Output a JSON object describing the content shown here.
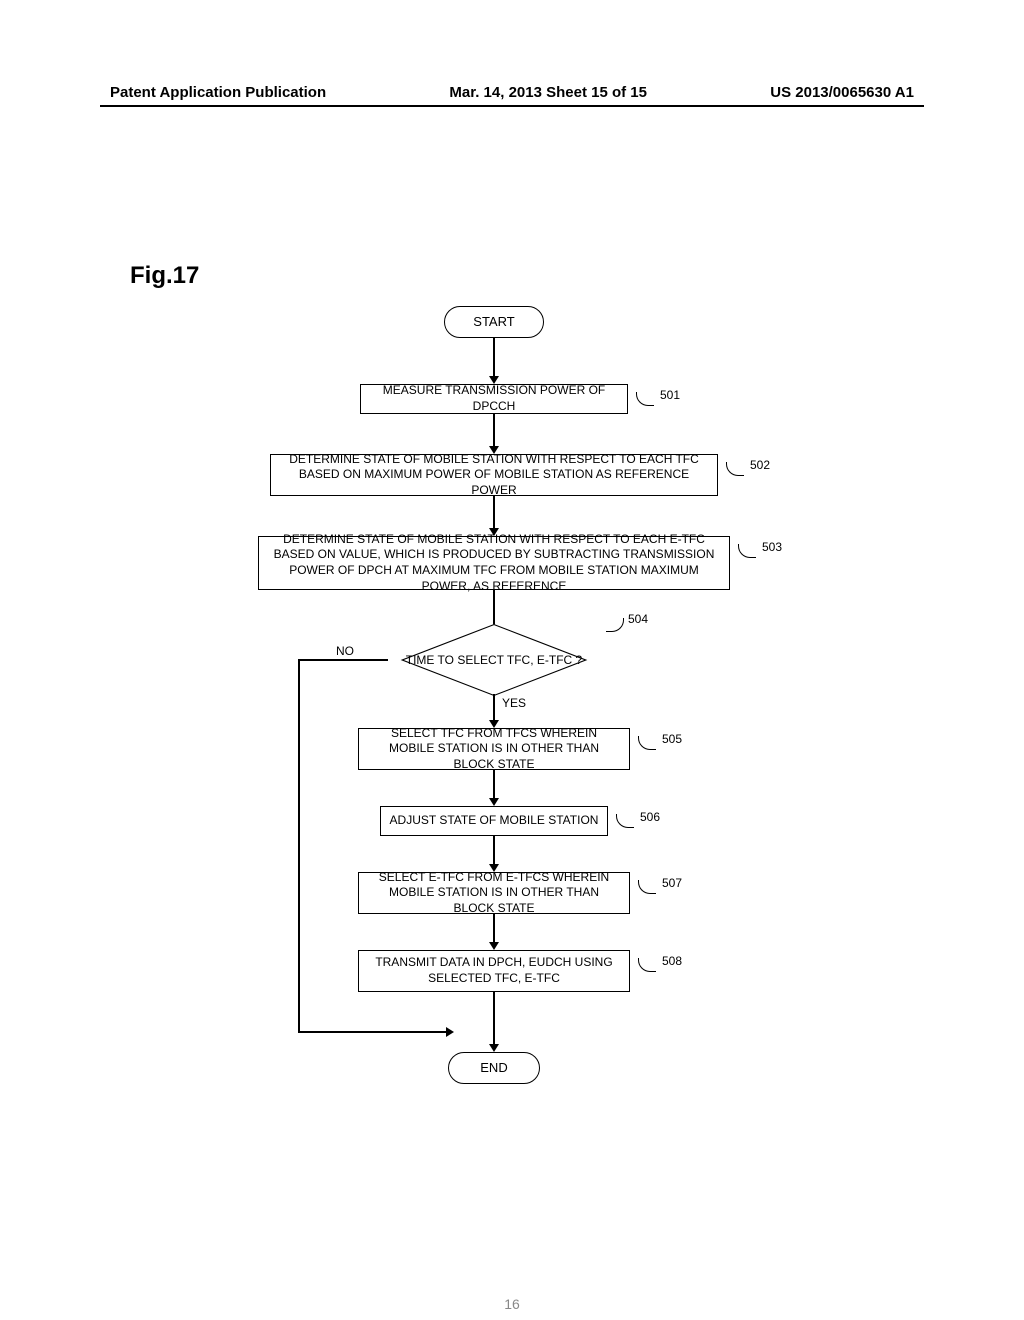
{
  "header": {
    "left": "Patent Application Publication",
    "center": "Mar. 14, 2013  Sheet 15 of 15",
    "right": "US 2013/0065630 A1"
  },
  "figure_label": "Fig.17",
  "nodes": {
    "start": "START",
    "s501": "MEASURE TRANSMISSION POWER OF DPCCH",
    "s502": "DETERMINE STATE OF MOBILE STATION WITH RESPECT TO EACH TFC BASED ON MAXIMUM POWER OF MOBILE STATION AS REFERENCE POWER",
    "s503": "DETERMINE STATE OF MOBILE STATION WITH RESPECT TO EACH E-TFC BASED ON VALUE, WHICH IS PRODUCED BY SUBTRACTING TRANSMISSION POWER OF DPCH AT MAXIMUM TFC FROM MOBILE STATION MAXIMUM POWER, AS REFERENCE",
    "s504": "TIME TO SELECT TFC, E-TFC ?",
    "s505": "SELECT TFC FROM TFCS WHEREIN MOBILE STATION IS IN OTHER THAN BLOCK STATE",
    "s506": "ADJUST STATE OF MOBILE STATION",
    "s507": "SELECT E-TFC FROM E-TFCS WHEREIN MOBILE STATION IS IN OTHER THAN BLOCK STATE",
    "s508": "TRANSMIT DATA IN DPCH, EUDCH USING SELECTED TFC, E-TFC",
    "end": "END"
  },
  "refs": {
    "r501": "501",
    "r502": "502",
    "r503": "503",
    "r504": "504",
    "r505": "505",
    "r506": "506",
    "r507": "507",
    "r508": "508"
  },
  "branches": {
    "no": "NO",
    "yes": "YES"
  },
  "page_number": "16"
}
